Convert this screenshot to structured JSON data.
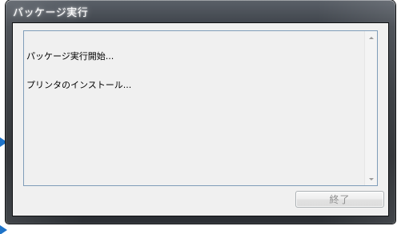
{
  "window": {
    "title": "パッケージ実行"
  },
  "log": {
    "lines": [
      "パッケージ実行開始...",
      "プリンタのインストール..."
    ]
  },
  "buttons": {
    "exit_label": "終了"
  },
  "icons": {
    "scroll_up": "scroll-up-arrow-icon",
    "scroll_down": "scroll-down-arrow-icon"
  },
  "colors": {
    "accent_arrow": "#1e73c8",
    "log_border": "#7f9db9",
    "client_bg": "#f0f0f0"
  }
}
